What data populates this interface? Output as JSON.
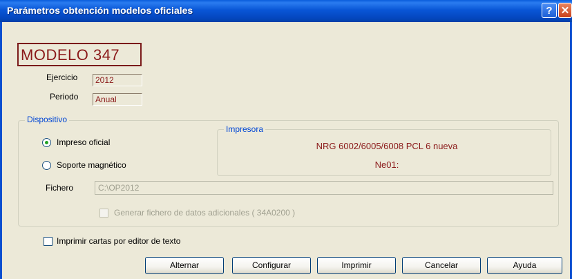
{
  "window": {
    "title": "Parámetros obtención modelos oficiales",
    "help_label": "?",
    "close_label": "✕"
  },
  "model": {
    "name": "MODELO 347"
  },
  "ejercicio": {
    "label": "Ejercicio",
    "value": "2012"
  },
  "periodo": {
    "label": "Periodo",
    "value": "Anual"
  },
  "dispositivo": {
    "title": "Dispositivo",
    "options": [
      {
        "label": "Impreso oficial",
        "selected": true
      },
      {
        "label": "Soporte magnético",
        "selected": false
      }
    ],
    "fichero_label": "Fichero",
    "fichero_value": "C:\\OP2012",
    "adicionales_label": "Generar fichero de datos adicionales ( 34A0200 )",
    "adicionales_checked": false
  },
  "impresora": {
    "title": "Impresora",
    "name": "NRG 6002/6005/6008 PCL 6 nueva",
    "port": "Ne01:"
  },
  "imprimir_cartas": {
    "label": "Imprimir cartas por editor de texto",
    "checked": false
  },
  "buttons": {
    "alternar": "Alternar",
    "configurar": "Configurar",
    "imprimir": "Imprimir",
    "cancelar": "Cancelar",
    "ayuda": "Ayuda"
  },
  "colors": {
    "titlebar": "#0a5ddb",
    "accent_text": "#8b1a1a",
    "group_title": "#0046d5",
    "background": "#ece9d8"
  }
}
